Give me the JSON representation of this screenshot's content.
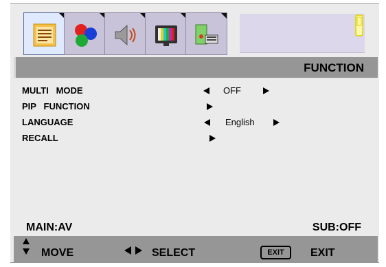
{
  "menu": {
    "tabs": [
      {
        "icon": "function-menu-icon",
        "active": true
      },
      {
        "icon": "color-balls-icon",
        "active": false
      },
      {
        "icon": "speaker-sound-icon",
        "active": false
      },
      {
        "icon": "tv-test-pattern-icon",
        "active": false
      },
      {
        "icon": "pc-keyboard-icon",
        "active": false
      }
    ],
    "band_icon": "tablet-icon",
    "title": "FUNCTION"
  },
  "items": [
    {
      "label": "MULTI   MODE",
      "value": "OFF"
    },
    {
      "label": "PIP   FUNCTION",
      "value": ""
    },
    {
      "label": "LANGUAGE",
      "value": "English"
    },
    {
      "label": "RECALL",
      "value": ""
    }
  ],
  "status": {
    "main": "MAIN:AV",
    "sub": "SUB:OFF"
  },
  "footer": {
    "move": "MOVE",
    "select": "SELECT",
    "exit_key": "EXIT",
    "exit": "EXIT"
  },
  "colors": {
    "panel": "#ebebeb",
    "bar": "#969696",
    "active_tab": "#dfe9ff",
    "tab": "#c9c3da"
  }
}
